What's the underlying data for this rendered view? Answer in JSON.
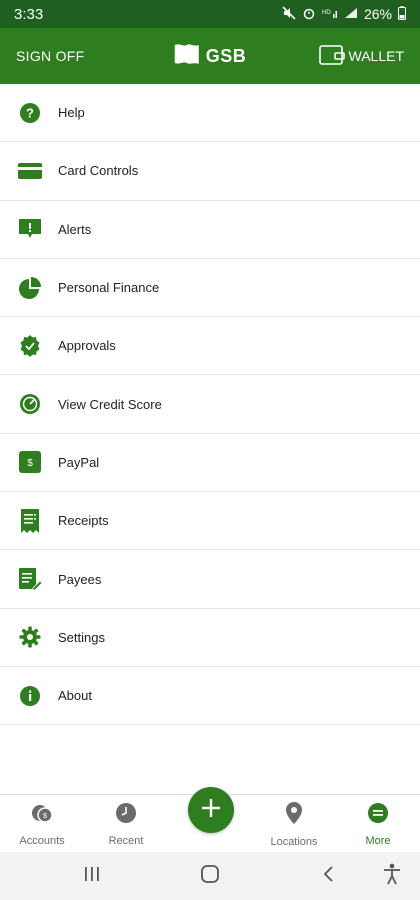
{
  "status_bar": {
    "time": "3:33",
    "battery": "26%"
  },
  "header": {
    "sign_off": "SIGN OFF",
    "brand": "GSB",
    "wallet": "WALLET"
  },
  "menu": [
    {
      "label": "Help",
      "icon": "help-icon"
    },
    {
      "label": "Card Controls",
      "icon": "card-icon"
    },
    {
      "label": "Alerts",
      "icon": "alert-icon"
    },
    {
      "label": "Personal Finance",
      "icon": "pie-chart-icon"
    },
    {
      "label": "Approvals",
      "icon": "approval-badge-icon"
    },
    {
      "label": "View Credit Score",
      "icon": "gauge-icon"
    },
    {
      "label": "PayPal",
      "icon": "paypal-icon"
    },
    {
      "label": "Receipts",
      "icon": "receipt-icon"
    },
    {
      "label": "Payees",
      "icon": "payee-icon"
    },
    {
      "label": "Settings",
      "icon": "gear-icon"
    },
    {
      "label": "About",
      "icon": "info-icon"
    }
  ],
  "bottom_nav": {
    "accounts": "Accounts",
    "recent": "Recent",
    "locations": "Locations",
    "more": "More",
    "active": "More"
  },
  "colors": {
    "status_bar": "#1f5f1f",
    "brand_green": "#2e7d1f",
    "nav_gray": "#6b6b6b"
  }
}
